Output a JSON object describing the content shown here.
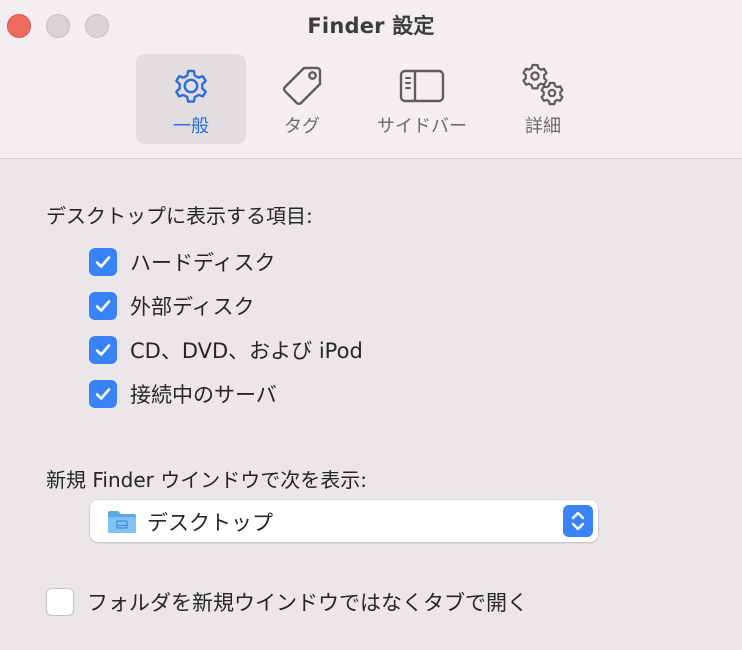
{
  "window": {
    "title": "Finder 設定"
  },
  "tabs": [
    {
      "label": "一般",
      "icon": "gear-icon",
      "active": true
    },
    {
      "label": "タグ",
      "icon": "tag-icon",
      "active": false
    },
    {
      "label": "サイドバー",
      "icon": "sidebar-icon",
      "active": false
    },
    {
      "label": "詳細",
      "icon": "gears-icon",
      "active": false
    }
  ],
  "desktop_section": {
    "label": "デスクトップに表示する項目:",
    "items": [
      {
        "label": "ハードディスク",
        "checked": true
      },
      {
        "label": "外部ディスク",
        "checked": true
      },
      {
        "label": "CD、DVD、および iPod",
        "checked": true
      },
      {
        "label": "接続中のサーバ",
        "checked": true
      }
    ]
  },
  "new_window_section": {
    "label": "新規 Finder ウインドウで次を表示:",
    "selected": "デスクトップ",
    "icon": "folder-icon"
  },
  "tabs_option": {
    "label": "フォルダを新規ウインドウではなくタブで開く",
    "checked": false
  },
  "colors": {
    "accent": "#3a82f7",
    "active_tab_text": "#2d6fd8",
    "close_button": "#ee6a5e",
    "window_bg": "#ebe6ea",
    "titlebar_bg": "#f3eef2"
  }
}
